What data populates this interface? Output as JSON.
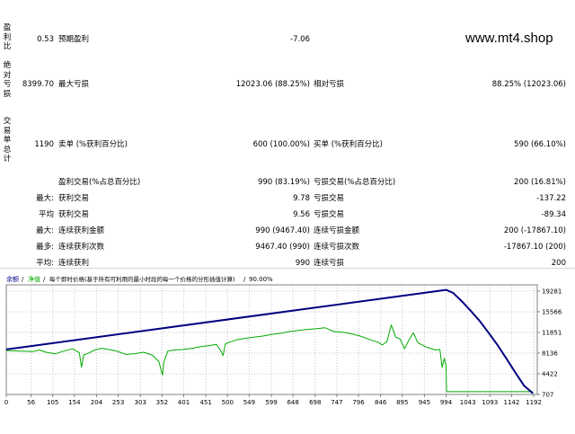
{
  "watermark": "www.mt4.shop",
  "rows": {
    "r1": {
      "side": "盈利比",
      "v1": "0.53",
      "l1": "预期盈利",
      "v2": "-7.06"
    },
    "r2": {
      "side": "绝对亏损",
      "v1": "8399.70",
      "l1": "最大亏损",
      "v2": "12023.06 (88.25%)",
      "l2": "相对亏损",
      "v3": "88.25% (12023.06)"
    },
    "r3": {
      "side": "交易单总计",
      "v1": "1190",
      "l1": "卖单 (%获利百分比)",
      "v2": "600 (100.00%)",
      "l2": "买单 (%获利百分比)",
      "v3": "590 (66.10%)"
    },
    "r4": {
      "pre": "",
      "l1": "盈利交易(%占总百分比)",
      "v2": "990 (83.19%)",
      "l2": "亏损交易(%占总百分比)",
      "v3": "200 (16.81%)"
    },
    "r5": {
      "pre": "最大:",
      "l1": "获利交易",
      "v2": "9.78",
      "l2": "亏损交易",
      "v3": "-137.22"
    },
    "r6": {
      "pre": "平均",
      "l1": "获利交易",
      "v2": "9.56",
      "l2": "亏损交易",
      "v3": "-89.34"
    },
    "r7": {
      "pre": "最大:",
      "l1": "连续获利金额",
      "v2": "990 (9467.40)",
      "l2": "连续亏损金额",
      "v3": "200 (-17867.10)"
    },
    "r8": {
      "pre": "最多:",
      "l1": "连续获利次数",
      "v2": "9467.40 (990)",
      "l2": "连续亏损次数",
      "v3": "-17867.10 (200)"
    },
    "r9": {
      "pre": "平均:",
      "l1": "连续获利",
      "v2": "990",
      "l2": "连续亏损",
      "v3": "200"
    }
  },
  "chart_header": {
    "balance": "余额",
    "sep1": "/",
    "equity": "净值",
    "sep2": "/",
    "desc": "每个即时价格(基于所有可利用的最小时段的每一个价格的分形插值计算)",
    "sep3": "/",
    "quality": "90.00%"
  },
  "chart_data": {
    "type": "line",
    "x_ticks": [
      0,
      56,
      105,
      154,
      204,
      253,
      303,
      352,
      401,
      451,
      500,
      549,
      599,
      648,
      698,
      747,
      796,
      846,
      895,
      945,
      994,
      1043,
      1093,
      1142,
      1192
    ],
    "y_ticks": [
      19281,
      15566,
      11851,
      8136,
      4422,
      707
    ],
    "xlim": [
      0,
      1200
    ],
    "ylim": [
      707,
      20400
    ],
    "colors": {
      "balance": "#000080",
      "equity": "#00aa00",
      "grid": "#c8c8c8",
      "axis": "#808080"
    },
    "series": [
      {
        "name": "余额",
        "x": [
          0,
          994,
          1010,
          1030,
          1050,
          1070,
          1090,
          1110,
          1130,
          1150,
          1170,
          1190
        ],
        "y": [
          8800,
          19500,
          18950,
          17400,
          15700,
          13900,
          11800,
          9600,
          7200,
          4700,
          2300,
          900
        ]
      },
      {
        "name": "净值",
        "x": [
          0,
          30,
          60,
          75,
          90,
          110,
          130,
          150,
          165,
          170,
          175,
          185,
          200,
          215,
          230,
          250,
          270,
          290,
          310,
          330,
          345,
          350,
          353,
          356,
          365,
          380,
          400,
          420,
          440,
          460,
          475,
          485,
          490,
          495,
          505,
          520,
          540,
          560,
          580,
          600,
          620,
          640,
          660,
          680,
          700,
          720,
          740,
          760,
          780,
          800,
          820,
          840,
          850,
          860,
          870,
          880,
          890,
          900,
          910,
          920,
          930,
          950,
          970,
          980,
          985,
          990,
          994,
          995,
          1000,
          1190
        ],
        "y": [
          8600,
          8500,
          8400,
          8700,
          8300,
          8000,
          8500,
          8900,
          8200,
          5600,
          7800,
          8100,
          8700,
          9000,
          8800,
          8500,
          7900,
          8000,
          8300,
          7800,
          6600,
          5000,
          4200,
          6500,
          8500,
          8700,
          8800,
          9000,
          9300,
          9500,
          9700,
          8500,
          7700,
          9800,
          10100,
          10500,
          10800,
          11000,
          11200,
          11500,
          11700,
          12000,
          12200,
          12400,
          12500,
          12700,
          12000,
          11900,
          11600,
          11200,
          10600,
          10100,
          9600,
          10200,
          13200,
          11000,
          10700,
          8900,
          10500,
          11800,
          10000,
          9200,
          8700,
          8800,
          5600,
          7200,
          5800,
          1200,
          1200,
          1200
        ]
      }
    ]
  }
}
